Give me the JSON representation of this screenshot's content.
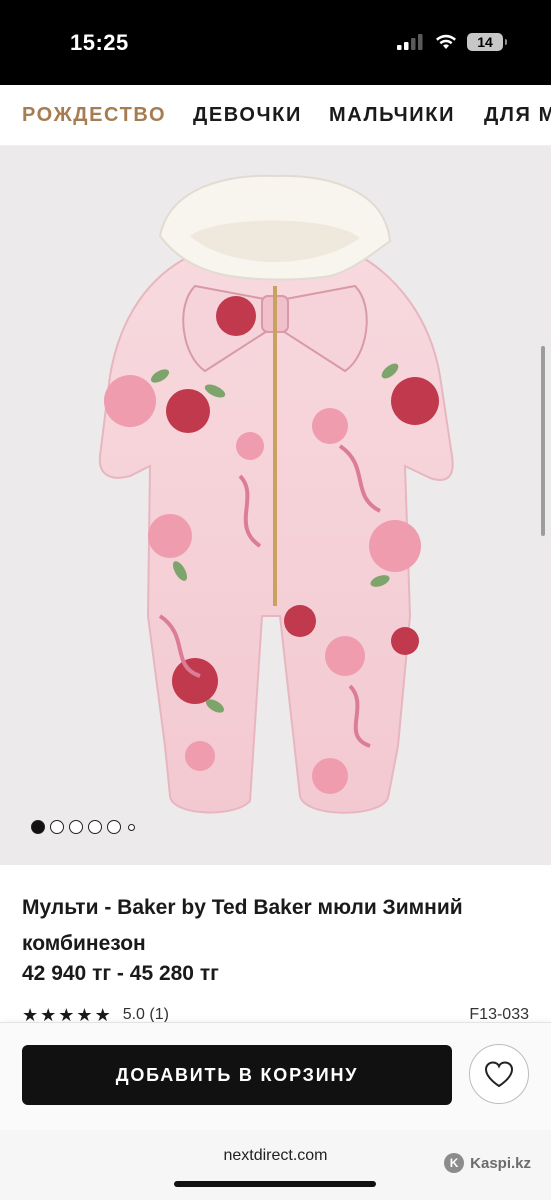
{
  "status_bar": {
    "time": "15:25",
    "battery": "14"
  },
  "nav": {
    "items": [
      {
        "label": "РОЖДЕСТВО",
        "active": true
      },
      {
        "label": "ДЕВОЧКИ",
        "active": false
      },
      {
        "label": "МАЛЬЧИКИ",
        "active": false
      },
      {
        "label": "ДЛЯ М",
        "active": false
      }
    ]
  },
  "gallery": {
    "image_icon": "snowsuit-image",
    "dots_count": 6,
    "active_index": 0
  },
  "product": {
    "title": "Мульти - Baker by Ted Baker мюли Зимний комбинезон",
    "price": "42 940 тг - 45 280 тг",
    "rating": "5.0 (1)",
    "stars": 5,
    "sku": "F13-033"
  },
  "actions": {
    "add_to_cart": "ДОБАВИТЬ В КОРЗИНУ",
    "wishlist_icon": "heart-icon"
  },
  "browser": {
    "url": "nextdirect.com"
  },
  "watermark": {
    "text": "Kaspi.kz"
  },
  "colors": {
    "accent": "#a67c52",
    "button": "#111111"
  }
}
